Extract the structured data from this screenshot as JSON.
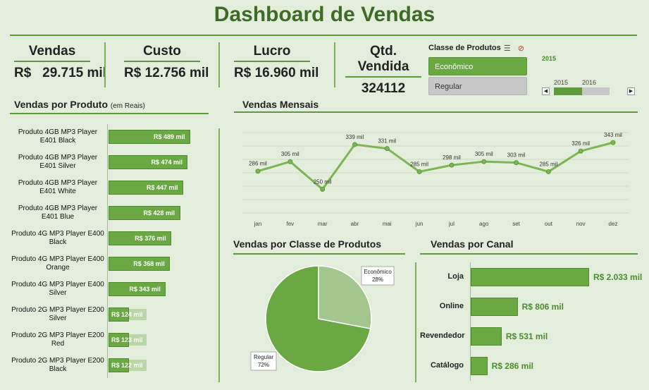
{
  "title": "Dashboard de Vendas",
  "kpis": [
    {
      "label": "Vendas",
      "value": "R$   29.715 mil"
    },
    {
      "label": "Custo",
      "value": "R$ 12.756 mil"
    },
    {
      "label": "Lucro",
      "value": "R$ 16.960 mil"
    },
    {
      "label": "Qtd. Vendida",
      "value": "324112"
    }
  ],
  "slicer": {
    "title": "Classe de Produtos",
    "options": [
      {
        "label": "Econômico",
        "selected": true
      },
      {
        "label": "Regular",
        "selected": false
      }
    ]
  },
  "timeline": {
    "selected_year": "2015",
    "years": [
      "2015",
      "2016"
    ],
    "fill_fraction": 0.5
  },
  "sections": {
    "produtos_title": "Vendas por Produto",
    "produtos_sub": "(em Reais)",
    "mensais_title": "Vendas Mensais",
    "classe_title": "Vendas por Classe de Produtos",
    "canal_title": "Vendas por Canal"
  },
  "colors": {
    "accent": "#6aa843",
    "accent_light": "#a2c68e",
    "title": "#3e6b25",
    "background": "#e2eedb"
  },
  "chart_data": [
    {
      "type": "bar",
      "orientation": "horizontal",
      "categories": [
        "Produto 4GB  MP3 Player E401 Black",
        "Produto 4GB  MP3 Player E401 Silver",
        "Produto 4GB  MP3 Player E401 White",
        "Produto 4GB  MP3 Player E401 Blue",
        "Produto 4G MP3 Player E400 Black",
        "Produto 4G MP3 Player E400 Orange",
        "Produto 4G MP3 Player E400 Silver",
        "Produto 2G MP3 Player E200 Silver",
        "Produto 2G MP3 Player E200 Red",
        "Produto 2G MP3 Player E200 Black"
      ],
      "values": [
        489,
        474,
        447,
        428,
        376,
        368,
        343,
        124,
        123,
        122
      ],
      "labels": [
        "R$ 489 mil",
        "R$ 474 mil",
        "R$ 447 mil",
        "R$ 428 mil",
        "R$ 376 mil",
        "R$ 368 mil",
        "R$ 343 mil",
        "R$ 124 mil",
        "R$ 123 mil",
        "R$ 122 mil"
      ],
      "title": "Vendas por Produto"
    },
    {
      "type": "line",
      "x": [
        "jan",
        "fev",
        "mar",
        "abr",
        "mai",
        "jun",
        "jul",
        "ago",
        "set",
        "out",
        "nov",
        "dez"
      ],
      "values": [
        286,
        305,
        250,
        339,
        331,
        285,
        298,
        305,
        303,
        285,
        326,
        343
      ],
      "labels": [
        "286 mil",
        "305 mil",
        "250 mil",
        "339 mil",
        "331 mil",
        "285 mil",
        "298 mil",
        "305 mil",
        "303 mil",
        "285 mil",
        "326 mil",
        "343 mil"
      ],
      "title": "Vendas Mensais",
      "grid": true
    },
    {
      "type": "pie",
      "categories": [
        "Econômico",
        "Regular"
      ],
      "values": [
        28,
        72
      ],
      "labels": [
        "28%",
        "72%"
      ],
      "title": "Vendas por Classe de Produtos"
    },
    {
      "type": "bar",
      "orientation": "horizontal",
      "categories": [
        "Loja",
        "Online",
        "Revendedor",
        "Catálogo"
      ],
      "values": [
        2033,
        806,
        531,
        286
      ],
      "labels": [
        "R$ 2.033 mil",
        "R$ 806 mil",
        "R$ 531 mil",
        "R$ 286 mil"
      ],
      "title": "Vendas por Canal"
    }
  ]
}
